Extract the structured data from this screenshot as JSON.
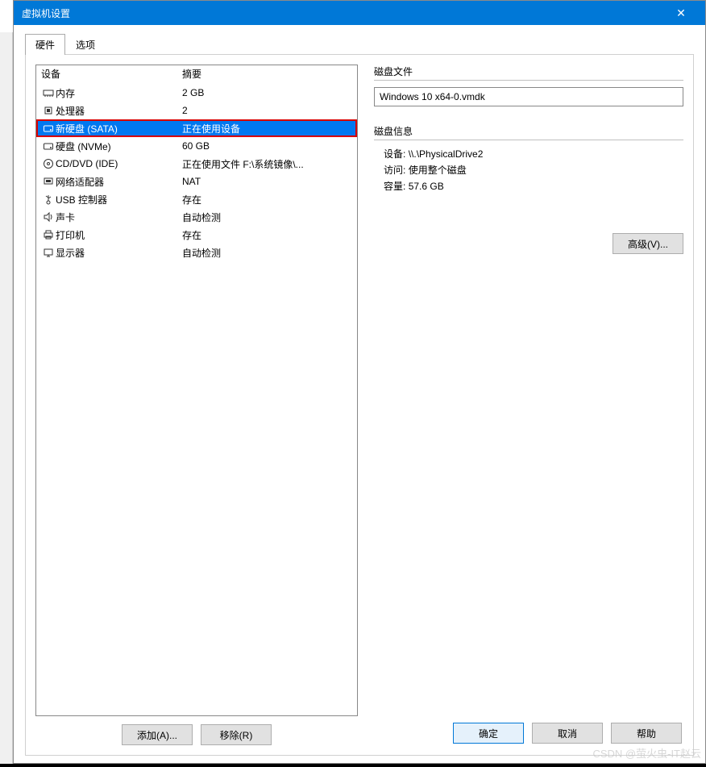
{
  "window": {
    "title": "虚拟机设置"
  },
  "tabs": {
    "hardware": "硬件",
    "options": "选项"
  },
  "list": {
    "head_device": "设备",
    "head_summary": "摘要",
    "rows": [
      {
        "name": "内存",
        "summary": "2 GB",
        "icon": "memory"
      },
      {
        "name": "处理器",
        "summary": "2",
        "icon": "cpu"
      },
      {
        "name": "新硬盘 (SATA)",
        "summary": "正在使用设备",
        "icon": "hdd",
        "selected": true
      },
      {
        "name": "硬盘 (NVMe)",
        "summary": "60 GB",
        "icon": "hdd"
      },
      {
        "name": "CD/DVD (IDE)",
        "summary": "正在使用文件 F:\\系统镜像\\...",
        "icon": "cd"
      },
      {
        "name": "网络适配器",
        "summary": "NAT",
        "icon": "net"
      },
      {
        "name": "USB 控制器",
        "summary": "存在",
        "icon": "usb"
      },
      {
        "name": "声卡",
        "summary": "自动检测",
        "icon": "sound"
      },
      {
        "name": "打印机",
        "summary": "存在",
        "icon": "printer"
      },
      {
        "name": "显示器",
        "summary": "自动检测",
        "icon": "display"
      }
    ]
  },
  "buttons": {
    "add": "添加(A)...",
    "remove": "移除(R)",
    "ok": "确定",
    "cancel": "取消",
    "help": "帮助",
    "advanced": "高级(V)..."
  },
  "disk_file": {
    "label": "磁盘文件",
    "value": "Windows 10 x64-0.vmdk"
  },
  "disk_info": {
    "label": "磁盘信息",
    "device_label": "设备:",
    "device_value": "\\\\.\\PhysicalDrive2",
    "access_label": "访问:",
    "access_value": "使用整个磁盘",
    "capacity_label": "容量:",
    "capacity_value": "57.6 GB"
  },
  "watermark": "CSDN @萤火虫-IT赵云"
}
